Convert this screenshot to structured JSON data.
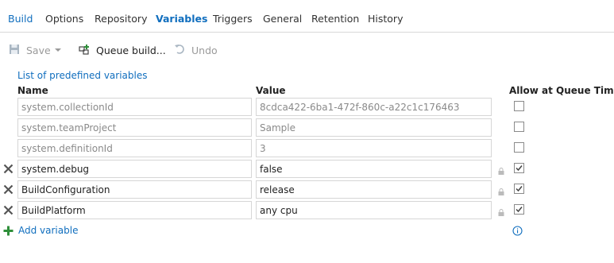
{
  "tabs": [
    {
      "label": "Build"
    },
    {
      "label": "Options"
    },
    {
      "label": "Repository"
    },
    {
      "label": "Variables"
    },
    {
      "label": "Triggers"
    },
    {
      "label": "General"
    },
    {
      "label": "Retention"
    },
    {
      "label": "History"
    }
  ],
  "active_tab": "Variables",
  "toolbar": {
    "save_label": "Save",
    "queue_label": "Queue build...",
    "undo_label": "Undo"
  },
  "predefined_link": "List of predefined variables",
  "columns": {
    "name": "Name",
    "value": "Value",
    "allow": "Allow at Queue Time"
  },
  "variables": [
    {
      "name": "system.collectionId",
      "value": "8cdca422-6ba1-472f-860c-a22c1c176463",
      "readonly": true,
      "allow": false
    },
    {
      "name": "system.teamProject",
      "value": "Sample",
      "readonly": true,
      "allow": false
    },
    {
      "name": "system.definitionId",
      "value": "3",
      "readonly": true,
      "allow": false
    },
    {
      "name": "system.debug",
      "value": "false",
      "readonly": false,
      "allow": true
    },
    {
      "name": "BuildConfiguration",
      "value": "release",
      "readonly": false,
      "allow": true
    },
    {
      "name": "BuildPlatform",
      "value": "any cpu",
      "readonly": false,
      "allow": true
    }
  ],
  "add_variable_label": "Add variable",
  "colors": {
    "accent": "#106ebe",
    "add_green": "#2f8f3a"
  }
}
